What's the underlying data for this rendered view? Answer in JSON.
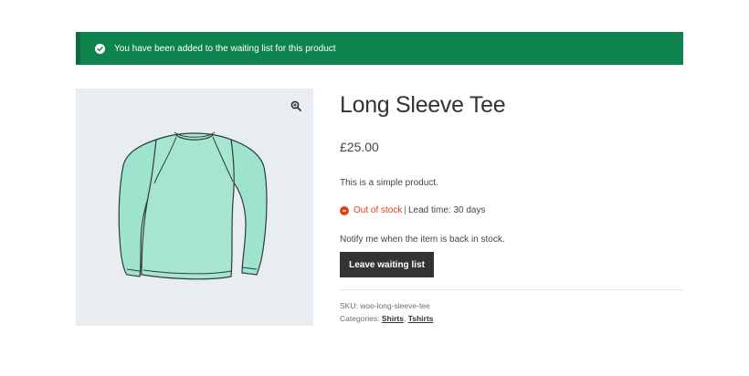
{
  "notice": {
    "message": "You have been added to the waiting list for this product",
    "background": "#0f834d"
  },
  "product": {
    "title": "Long Sleeve Tee",
    "price": "£25.00",
    "description": "This is a simple product.",
    "stock_status": "Out of stock",
    "stock_separator": "|",
    "lead_time": "Lead time: 30 days",
    "notify_text": "Notify me when the item is back in stock.",
    "waitlist_button_label": "Leave waiting list",
    "sku_label": "SKU:",
    "sku_value": "woo-long-sleeve-tee",
    "categories_label": "Categories:",
    "categories": [
      "Shirts",
      "Tshirts"
    ],
    "category_separator": ","
  },
  "icons": {
    "notice": "check-circle-icon",
    "zoom": "zoom-in-icon",
    "stock": "out-of-stock-icon"
  },
  "colors": {
    "accent": "#0f834d",
    "out_of_stock": "#e2401c",
    "button": "#333333",
    "gallery_bg": "#e8edf2"
  }
}
